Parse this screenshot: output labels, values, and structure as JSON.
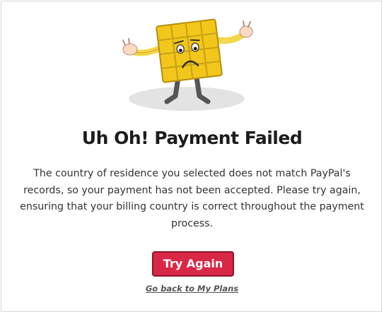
{
  "dialog": {
    "illustration_icon": "sad-waffle-mascot-icon",
    "title": "Uh Oh! Payment Failed",
    "message": "The country of residence you selected does not match PayPal's records, so your payment has not been accepted. Please try again, ensuring that your billing country is correct throughout the payment process.",
    "try_again_label": "Try Again",
    "back_link_label": "Go back to My Plans"
  },
  "colors": {
    "button_fill": "#d92747",
    "button_border": "#8e1328",
    "mascot_body": "#f2c61b",
    "title_text": "#1c1c1c"
  }
}
